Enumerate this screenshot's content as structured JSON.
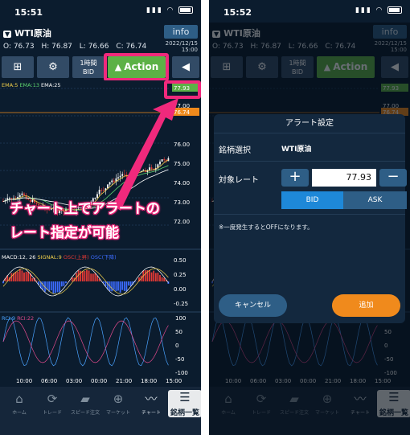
{
  "left": {
    "time": "15:51",
    "symbol": "WTI原油",
    "info": "info",
    "ohlc": {
      "o": "O: 76.73",
      "h": "H: 76.87",
      "l": "L: 76.66",
      "c": "C: 76.74"
    },
    "datetime": [
      "2022/12/15",
      "15:00"
    ],
    "toolbar": {
      "period": "1時間",
      "bidask": "BID",
      "action": "Action"
    },
    "ema": [
      "EMA:5",
      "EMA:13",
      "EMA:25"
    ],
    "price_tags": [
      "77.93",
      "77.00",
      "76.74",
      "76.00",
      "75.00",
      "74.00",
      "73.00",
      "72.00"
    ],
    "macd_labels": [
      "MACD:12, 26",
      "SIGNAL:9",
      "OSC(上昇)",
      "OSC(下降)"
    ],
    "macd_ticks": [
      "0.50",
      "0.25",
      "0.00",
      "-0.25"
    ],
    "rci_labels": [
      "RCI:9",
      "RCI:22"
    ],
    "rci_ticks": [
      "100",
      "50",
      "0",
      "-50",
      "-100"
    ],
    "x_ticks": [
      "10:00",
      "06:00",
      "03:00",
      "00:00",
      "21:00",
      "18:00",
      "15:00"
    ],
    "callout": [
      "チャート上でアラートの",
      "レート指定が可能"
    ]
  },
  "right": {
    "time": "15:52",
    "dialog": {
      "title": "アラート設定",
      "symbol_label": "銘柄選択",
      "symbol_value": "WTI原油",
      "rate_label": "対象レート",
      "plus": "+",
      "minus": "−",
      "rate_value": "77.93",
      "bid": "BID",
      "ask": "ASK",
      "note": "※一度発生するとOFFになります。",
      "cancel": "キャンセル",
      "add": "追加"
    }
  },
  "tabs": [
    {
      "label": "ホーム",
      "icon": "home-icon",
      "glyph": "⌂"
    },
    {
      "label": "トレード",
      "icon": "trade-icon",
      "glyph": "⟳"
    },
    {
      "label": "スピード注文",
      "icon": "speed-order-icon",
      "glyph": "▰"
    },
    {
      "label": "マーケット",
      "icon": "market-icon",
      "glyph": "⊕"
    },
    {
      "label": "チャート",
      "icon": "chart-icon",
      "glyph": "〰"
    },
    {
      "label": "銘柄一覧",
      "icon": "symbol-list-icon",
      "glyph": "☰"
    }
  ],
  "colors": {
    "action_green": "#5cb146",
    "highlight_pink": "#f0297c",
    "add_orange": "#f08a1c",
    "bg": "#0b1c2e",
    "bid_blue": "#1e88d8"
  }
}
